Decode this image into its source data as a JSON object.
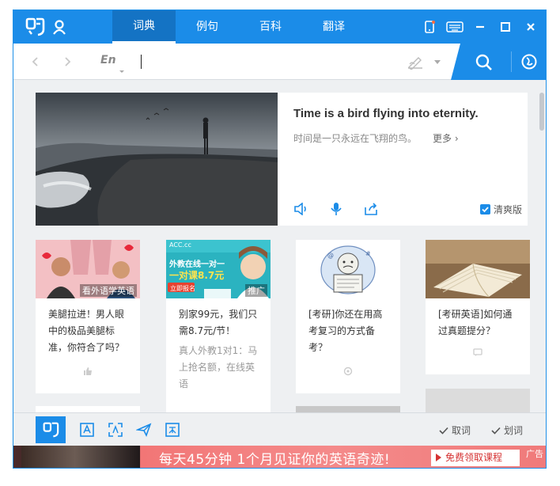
{
  "titlebar": {
    "tabs": [
      {
        "label": "词典",
        "active": true
      },
      {
        "label": "例句",
        "active": false
      },
      {
        "label": "百科",
        "active": false
      },
      {
        "label": "翻译",
        "active": false
      }
    ],
    "accent_color": "#1b8ce8"
  },
  "search": {
    "lang_toggle": "En",
    "value": "",
    "placeholder": ""
  },
  "daily_sentence": {
    "english": "Time is a bird flying into eternity.",
    "chinese": "时间是一只永远在飞翔的鸟。",
    "more_label": "更多 ›",
    "checkbox_label": "清爽版",
    "checkbox_checked": true
  },
  "articles": [
    {
      "title": "美腿拉进！男人眼中的极品美腿标准，你符合了吗？",
      "badge": "看外语学英语",
      "meta": "顶 赞"
    },
    {
      "title": "别家99元，我们只需8.7元/节！",
      "summary": "真人外教1对1：马上抢名额，在线英语",
      "badge": "推广"
    },
    {
      "title": "[考研]你还在用高考复习的方式备考？",
      "meta": ""
    },
    {
      "title": "[考研英语]如何通过真题提分？",
      "meta": ""
    }
  ],
  "ad_thumbnail": {
    "line1": "ACC.cc",
    "line2": "外教在线一对一",
    "line3": "一对课8.7元",
    "cta": "立即报名"
  },
  "bottombar": {
    "filters": [
      {
        "label": "取词",
        "checked": true
      },
      {
        "label": "划词",
        "checked": true
      }
    ]
  },
  "ad_banner": {
    "text": "每天45分钟 1个月见证你的英语奇迹!",
    "button": "免费领取课程",
    "close": "广告"
  }
}
